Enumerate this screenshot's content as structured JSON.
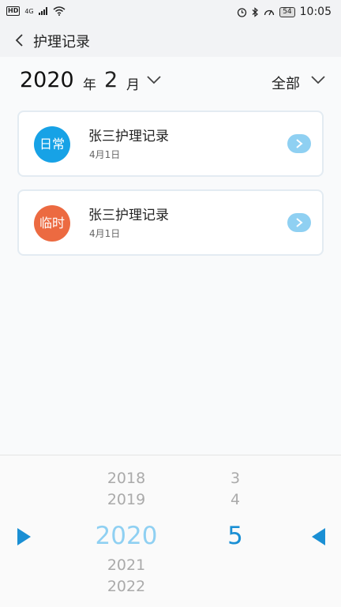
{
  "status_bar": {
    "hd": "HD",
    "network": "4G",
    "battery": "54",
    "time": "10:05"
  },
  "header": {
    "title": "护理记录"
  },
  "filter": {
    "year": "2020",
    "year_unit": "年",
    "month": "2",
    "month_unit": "月",
    "category": "全部"
  },
  "records": [
    {
      "type": "日常",
      "title": "张三护理记录",
      "date": "4月1日",
      "color": "#17a2e6"
    },
    {
      "type": "临时",
      "title": "张三护理记录",
      "date": "4月1日",
      "color": "#ec6a41"
    }
  ],
  "picker": {
    "years": [
      "2018",
      "2019",
      "2020",
      "2021",
      "2022"
    ],
    "selected_year": "2020",
    "months": [
      "3",
      "4",
      "5"
    ],
    "selected_month": "5"
  }
}
